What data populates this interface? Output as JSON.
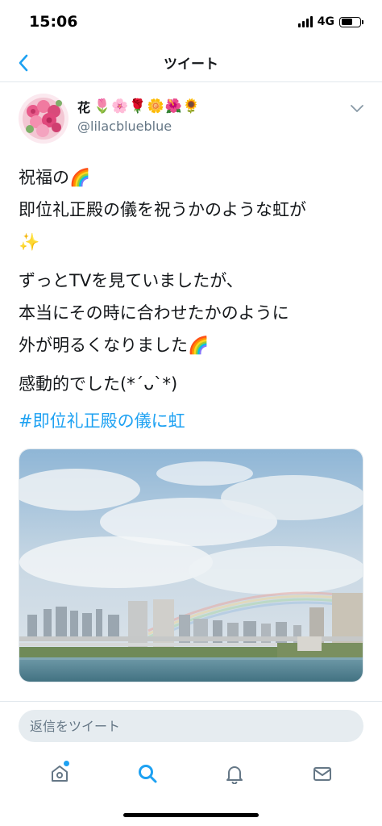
{
  "status_bar": {
    "time": "15:06",
    "network": "4G"
  },
  "header": {
    "title": "ツイート"
  },
  "tweet": {
    "user_name": "花",
    "user_emojis": "🌷🌸🌹🌼🌺🌻",
    "user_handle": "@lilacblueblue",
    "paragraphs": [
      {
        "lines": [
          "祝福の🌈",
          "即位礼正殿の儀を祝うかのような虹が",
          "✨"
        ]
      },
      {
        "lines": [
          "ずっとTVを見ていましたが、",
          "本当にその時に合わせたかのように",
          "外が明るくなりました🌈"
        ]
      },
      {
        "lines": [
          "感動的でした(*´ᴗ`*)"
        ]
      }
    ],
    "hashtag": "#即位礼正殿の儀に虹"
  },
  "reply": {
    "placeholder": "返信をツイート"
  },
  "tabs": [
    {
      "name": "home",
      "icon": "home-icon"
    },
    {
      "name": "search",
      "icon": "search-icon"
    },
    {
      "name": "notifications",
      "icon": "bell-icon"
    },
    {
      "name": "messages",
      "icon": "mail-icon"
    }
  ],
  "colors": {
    "accent": "#1da1f2",
    "secondary_text": "#657786",
    "divider": "#e1e8ed"
  }
}
